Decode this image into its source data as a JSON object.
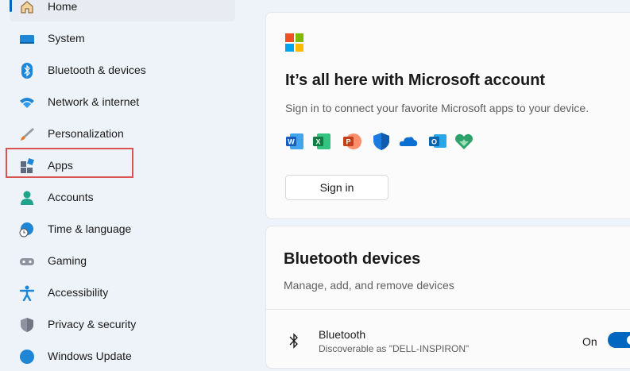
{
  "sidebar": {
    "items": [
      {
        "label": "Home",
        "icon": "home-icon"
      },
      {
        "label": "System",
        "icon": "monitor-icon"
      },
      {
        "label": "Bluetooth & devices",
        "icon": "bluetooth-icon"
      },
      {
        "label": "Network & internet",
        "icon": "wifi-icon"
      },
      {
        "label": "Personalization",
        "icon": "brush-icon"
      },
      {
        "label": "Apps",
        "icon": "apps-icon"
      },
      {
        "label": "Accounts",
        "icon": "person-icon"
      },
      {
        "label": "Time & language",
        "icon": "globe-clock-icon"
      },
      {
        "label": "Gaming",
        "icon": "gamepad-icon"
      },
      {
        "label": "Accessibility",
        "icon": "accessibility-icon"
      },
      {
        "label": "Privacy & security",
        "icon": "shield-icon"
      },
      {
        "label": "Windows Update",
        "icon": "update-icon"
      }
    ],
    "active_index": 0,
    "highlighted_index": 5
  },
  "account_card": {
    "title": "It’s all here with Microsoft account",
    "subtitle": "Sign in to connect your favorite Microsoft apps to your device.",
    "apps": [
      "word-icon",
      "excel-icon",
      "powerpoint-icon",
      "defender-icon",
      "onedrive-icon",
      "outlook-icon",
      "family-icon"
    ],
    "signin_label": "Sign in"
  },
  "bluetooth_card": {
    "title": "Bluetooth devices",
    "subtitle": "Manage, add, and remove devices",
    "row": {
      "name": "Bluetooth",
      "description": "Discoverable as \"DELL-INSPIRON\"",
      "state_label": "On"
    }
  },
  "colors": {
    "accent": "#0067c0",
    "highlight_border": "#d9534f",
    "window_bg": "#eef2f9"
  }
}
